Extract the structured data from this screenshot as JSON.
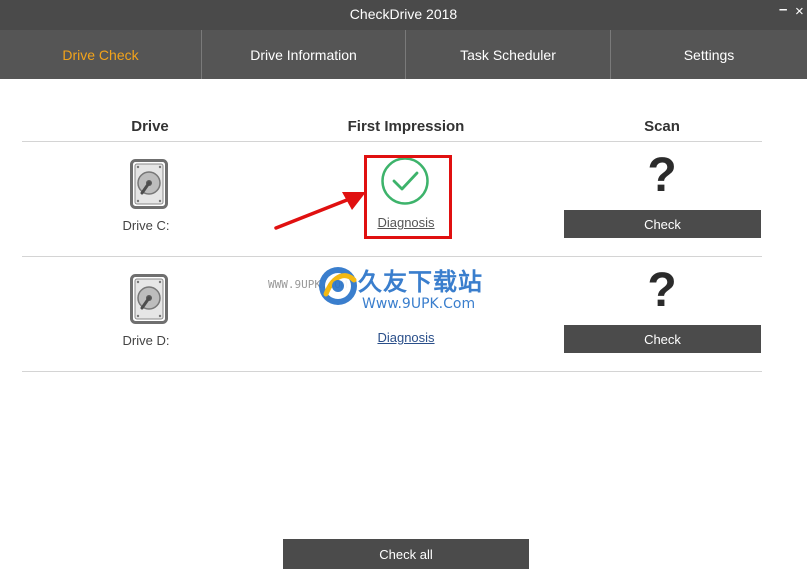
{
  "window": {
    "title": "CheckDrive 2018",
    "minimize_glyph": "–",
    "close_glyph": "×"
  },
  "tabs": [
    {
      "label": "Drive Check",
      "active": true
    },
    {
      "label": "Drive Information",
      "active": false
    },
    {
      "label": "Task Scheduler",
      "active": false
    },
    {
      "label": "Settings",
      "active": false
    }
  ],
  "columns": {
    "drive": "Drive",
    "first_impression": "First Impression",
    "scan": "Scan"
  },
  "drives": [
    {
      "label": "Drive C:",
      "icon": "hard-drive-icon",
      "status_icon": "check-circle-icon",
      "diagnosis_label": "Diagnosis",
      "scan_status": "?",
      "check_label": "Check"
    },
    {
      "label": "Drive D:",
      "icon": "hard-drive-icon",
      "status_icon": "hidden-by-watermark",
      "diagnosis_label": "Diagnosis",
      "scan_status": "?",
      "check_label": "Check"
    }
  ],
  "footer": {
    "check_all_label": "Check all"
  },
  "watermark": {
    "cn_text": "久友下载站",
    "url": "Www.9UPK.Com",
    "side_text": "WWW.9UPK.COM"
  },
  "colors": {
    "active_tab": "#f2a31a",
    "tab_bar": "#555555",
    "title_bar": "#4a4a4a",
    "check_green": "#3db36b",
    "annotation_red": "#e01010",
    "button_bg": "#4b4b4b",
    "watermark_blue": "#2a74c9"
  }
}
